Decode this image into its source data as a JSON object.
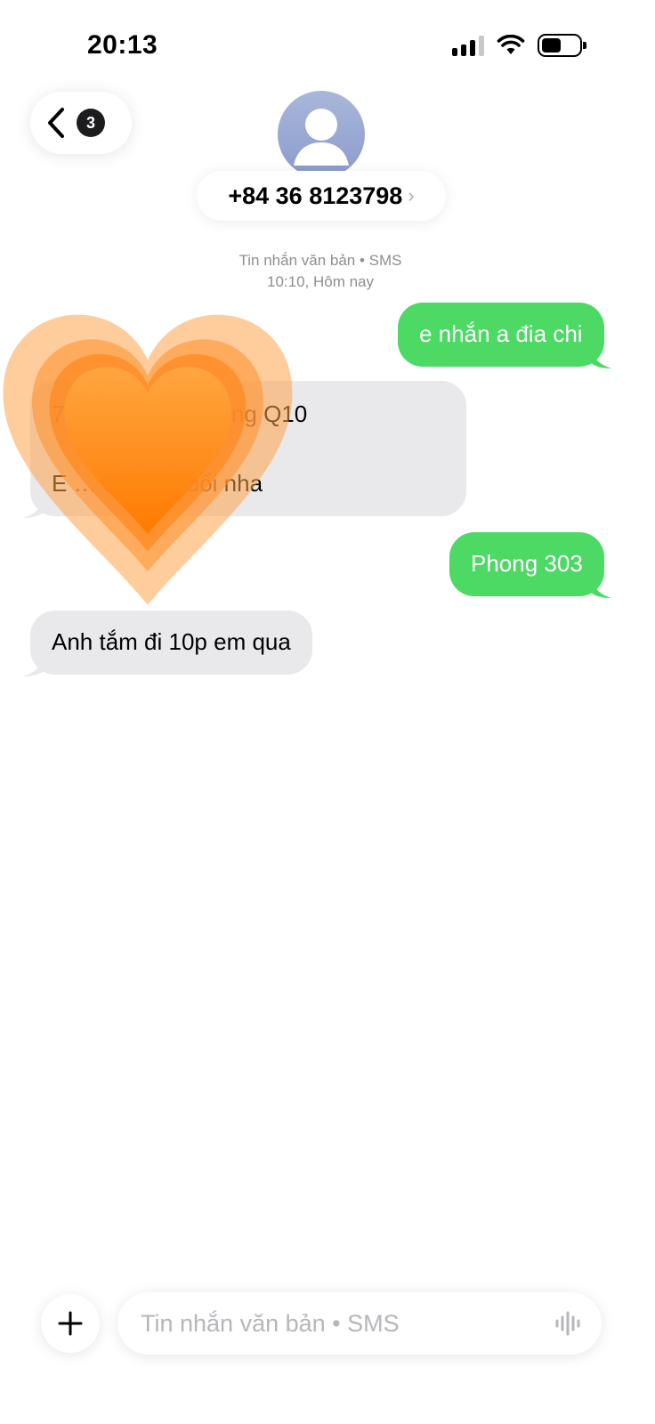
{
  "status_bar": {
    "time": "20:13",
    "icons": [
      "cellular-signal-icon",
      "wifi-icon",
      "battery-icon"
    ]
  },
  "header": {
    "back_badge_count": "3",
    "contact_name": "+84 36 8123798",
    "contact_chevron": "›"
  },
  "thread_meta": {
    "service": "Tin nhắn văn bản • SMS",
    "timestamp": "10:10, Hôm nay"
  },
  "messages": [
    {
      "side": "sent",
      "lines": [
        "e nhắn a đia chi"
      ]
    },
    {
      "side": "received",
      "lines": [
        "70 … h P hòa Hưng Q10",
        "E … quá 50 tuổi nha"
      ]
    },
    {
      "side": "sent",
      "lines": [
        "Phong 303"
      ]
    },
    {
      "side": "received",
      "lines": [
        "Anh tắm đi 10p em qua"
      ]
    }
  ],
  "reaction": {
    "icon": "orange-heart-emoji",
    "color": "#ff7f00"
  },
  "composer": {
    "placeholder": "Tin nhắn văn bản • SMS"
  },
  "colors": {
    "sent_bubble": "#4cd964",
    "received_bubble": "#e9e9eb",
    "meta_text": "#8e8e93"
  }
}
